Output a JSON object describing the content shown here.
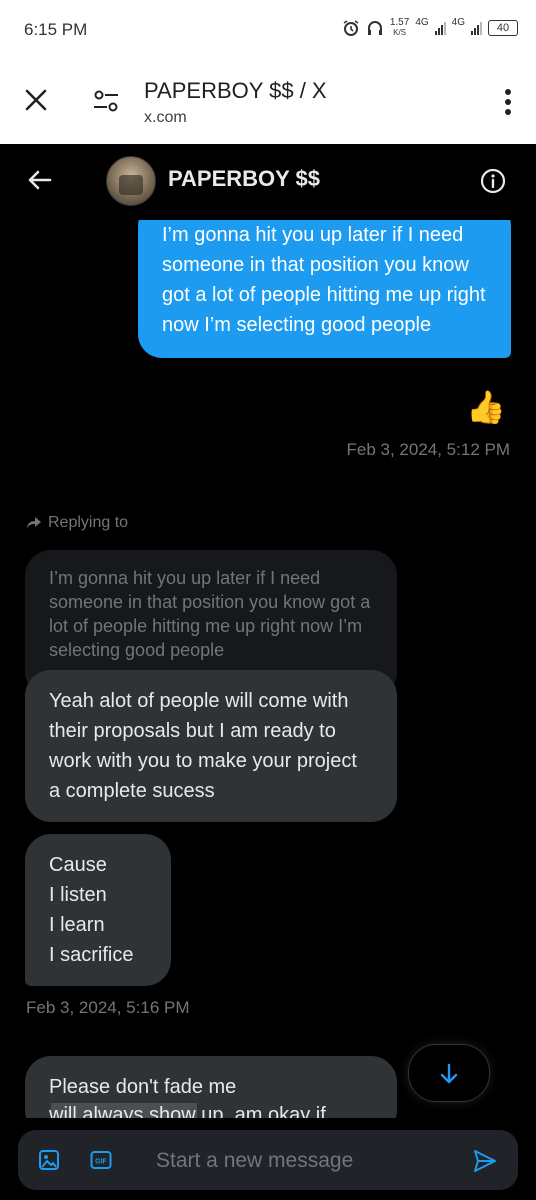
{
  "statusbar": {
    "time": "6:15 PM",
    "net_speed_value": "1.57",
    "net_speed_unit": "K/S",
    "network_1": "4G",
    "network_2": "4G",
    "battery": "40"
  },
  "browser": {
    "page_title": "PAPERBOY $$ / X",
    "url": "x.com"
  },
  "conversation": {
    "name": "PAPERBOY $$"
  },
  "messages": {
    "outgoing_text": "I’m gonna hit you up later if I need someone in that position you know got a lot of people hitting me up right now I’m selecting good people",
    "reaction": "👍",
    "outgoing_time": "Feb 3, 2024, 5:12 PM",
    "replying_label": "Replying to",
    "quoted_text": "I’m gonna hit you up later if I need someone in that position you know got a lot of people hitting me up right now I’m selecting good people",
    "incoming_1": "Yeah alot of people will come with their proposals but I am ready to work with you to make your project a complete sucess",
    "incoming_2_lines": [
      "Cause",
      "I listen",
      "I learn",
      "I sacrifice"
    ],
    "incoming_time": "Feb 3, 2024, 5:16 PM",
    "incoming_3_line1": "Please don't fade me",
    "incoming_3_line2": "will always show up, am okay if"
  },
  "composer": {
    "placeholder": "Start a new message"
  },
  "colors": {
    "accent": "#1d9bf0",
    "incoming_bubble": "#2f3336",
    "background": "#000000"
  },
  "icons": [
    "alarm-icon",
    "headphones-icon",
    "close-icon",
    "site-settings-icon",
    "more-vert-icon",
    "back-arrow-icon",
    "info-icon",
    "reply-arrow-icon",
    "arrow-down-icon",
    "image-icon",
    "gif-icon",
    "send-icon"
  ]
}
